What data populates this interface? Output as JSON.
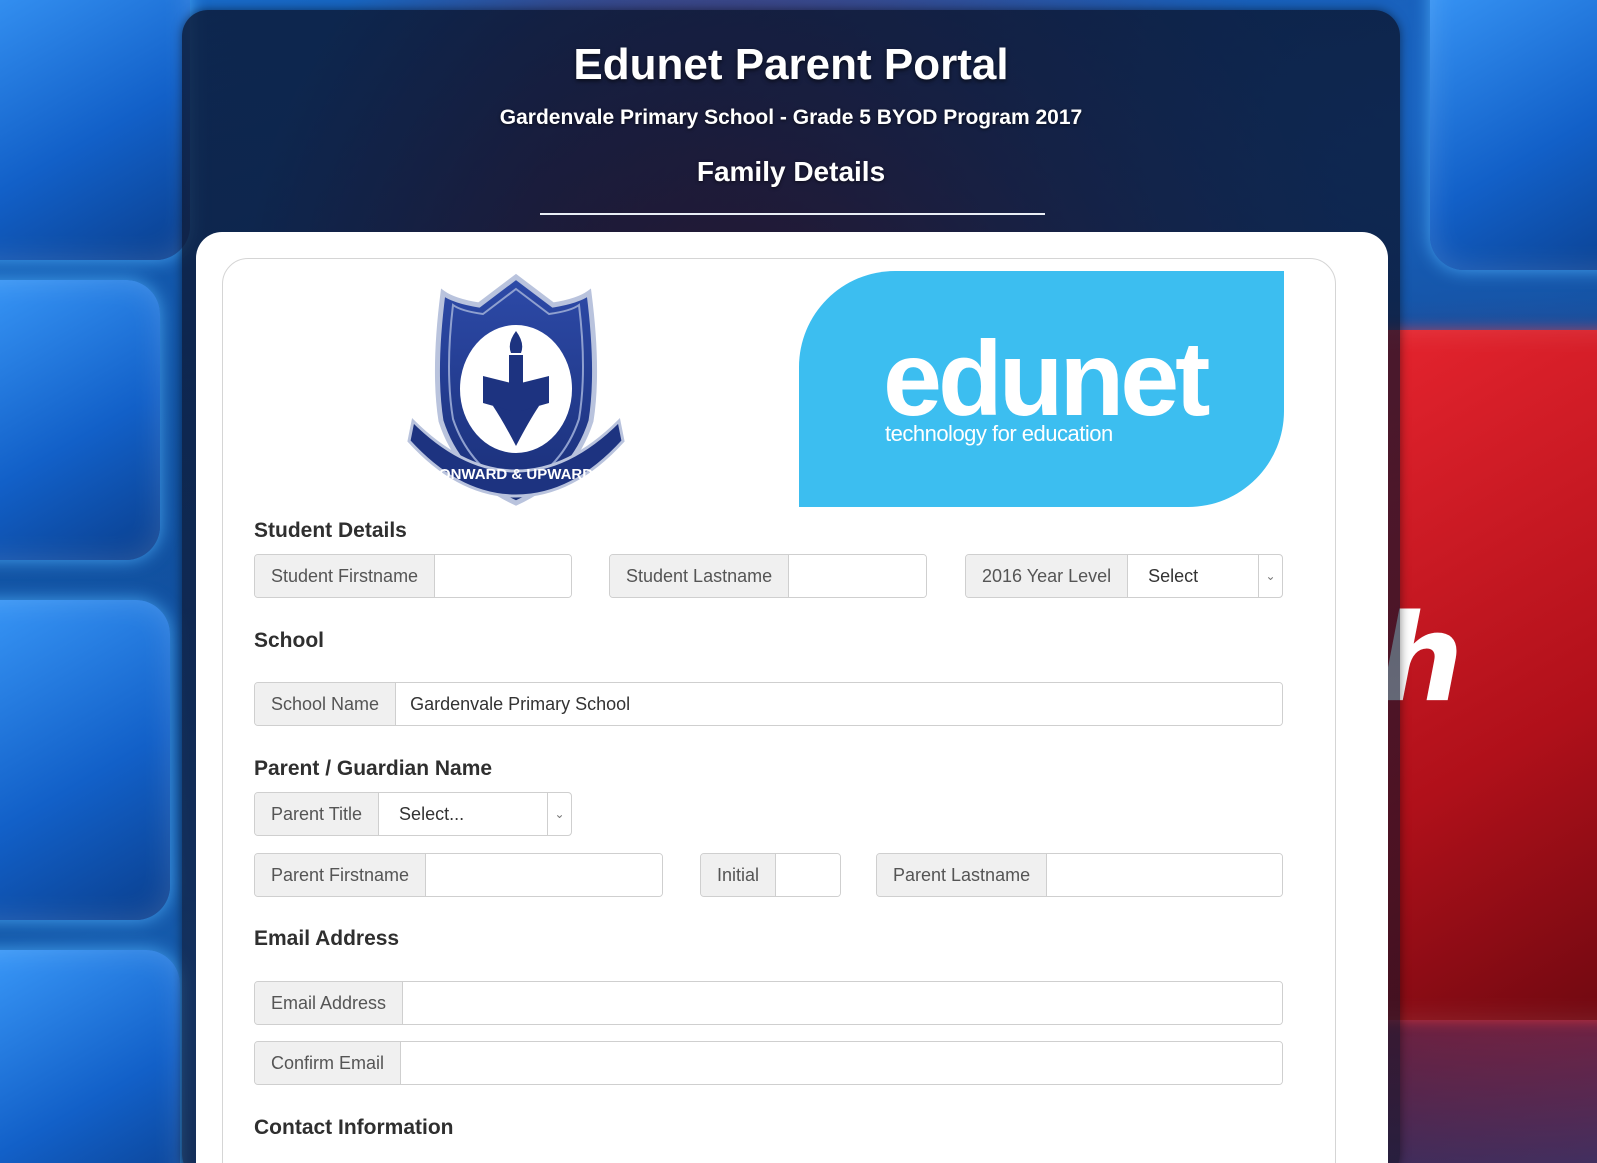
{
  "header": {
    "title": "Edunet Parent Portal",
    "subtitle": "Gardenvale Primary School - Grade 5 BYOD Program 2017",
    "section": "Family Details"
  },
  "logos": {
    "crest_motto": "ONWARD & UPWARD",
    "edunet_word": "edunet",
    "edunet_tagline": "technology for education",
    "edunet_color": "#3cbef0"
  },
  "student": {
    "heading": "Student Details",
    "firstname_label": "Student Firstname",
    "firstname_value": "",
    "lastname_label": "Student Lastname",
    "lastname_value": "",
    "year_label": "2016 Year Level",
    "year_selected": "Select"
  },
  "school": {
    "heading": "School",
    "name_label": "School Name",
    "name_value": "Gardenvale Primary School"
  },
  "parent": {
    "heading": "Parent / Guardian Name",
    "title_label": "Parent Title",
    "title_selected": "Select...",
    "firstname_label": "Parent Firstname",
    "firstname_value": "",
    "initial_label": "Initial",
    "initial_value": "",
    "lastname_label": "Parent Lastname",
    "lastname_value": ""
  },
  "email": {
    "heading": "Email Address",
    "email_label": "Email Address",
    "email_value": "",
    "confirm_label": "Confirm Email",
    "confirm_value": ""
  },
  "contact": {
    "heading": "Contact Information"
  },
  "background": {
    "key_glyph": "h"
  },
  "icons": {
    "select_chevron": "chevron-down-icon"
  }
}
